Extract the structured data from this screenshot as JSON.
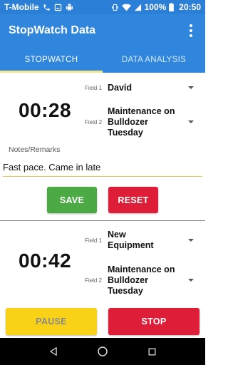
{
  "status_bar": {
    "carrier": "T-Mobile",
    "battery": "100%",
    "time": "20:50"
  },
  "app_bar": {
    "title": "StopWatch Data"
  },
  "tabs": [
    {
      "label": "STOPWATCH",
      "active": true
    },
    {
      "label": "DATA ANALYSIS",
      "active": false
    }
  ],
  "card1": {
    "timer": "00:28",
    "field1_label": "Field 1",
    "field1_value": "David",
    "field2_label": "Field 2",
    "field2_value": "Maintenance on Bulldozer Tuesday",
    "notes_label": "Notes/Remarks",
    "notes_value": "Fast pace. Came in late",
    "save_label": "SAVE",
    "reset_label": "RESET"
  },
  "card2": {
    "timer": "00:42",
    "field1_label": "Field 1",
    "field1_value": "New Equipment",
    "field2_label": "Field 2",
    "field2_value": "Maintenance on Bulldozer Tuesday",
    "pause_label": "PAUSE",
    "stop_label": "STOP"
  },
  "colors": {
    "primary": "#2f86dc",
    "status_bar": "#2b7fd6",
    "tab_indicator": "#f7e589",
    "save": "#4caa44",
    "reset": "#de1d38",
    "pause": "#f9d217",
    "stop": "#de1d38"
  },
  "icons": [
    "phone-icon",
    "image-icon",
    "android-debug-icon",
    "vibrate-icon",
    "wifi-icon",
    "signal-icon",
    "battery-icon",
    "overflow-menu-icon",
    "dropdown-arrow-icon",
    "back-icon",
    "home-icon",
    "recents-icon"
  ]
}
